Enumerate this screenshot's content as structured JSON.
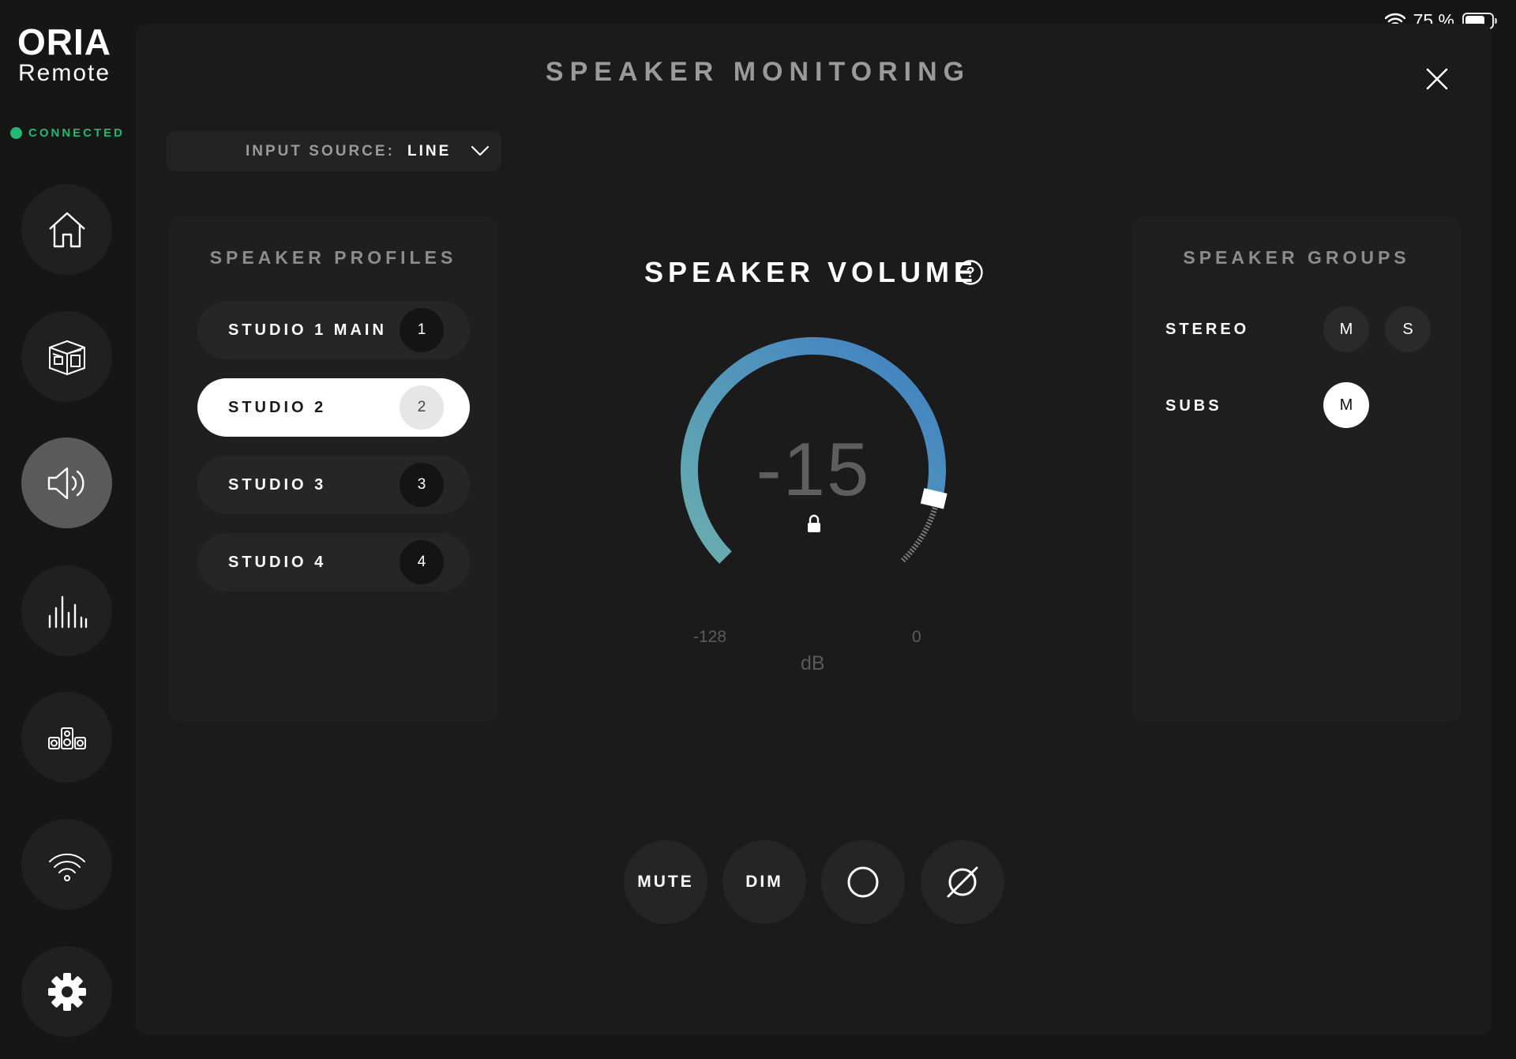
{
  "status_bar": {
    "battery": "75 %",
    "battery_level": 0.75
  },
  "sidebar": {
    "logo_line1": "ORIA",
    "logo_line2": "Remote",
    "connection": "CONNECTED",
    "connection_color": "#25b872",
    "nav": [
      {
        "icon": "home-icon",
        "active": false
      },
      {
        "icon": "room-icon",
        "active": false
      },
      {
        "icon": "speaker-icon",
        "active": true
      },
      {
        "icon": "equalizer-icon",
        "active": false
      },
      {
        "icon": "speakers-layout-icon",
        "active": false
      },
      {
        "icon": "wifi-icon",
        "active": false
      },
      {
        "icon": "gear-icon",
        "active": false
      }
    ]
  },
  "page": {
    "title": "SPEAKER MONITORING"
  },
  "input_source": {
    "label": "INPUT SOURCE:",
    "value": "LINE"
  },
  "profiles": {
    "title": "SPEAKER PROFILES",
    "items": [
      {
        "name": "STUDIO 1 MAIN",
        "num": "1",
        "active": false
      },
      {
        "name": "STUDIO 2",
        "num": "2",
        "active": true
      },
      {
        "name": "STUDIO 3",
        "num": "3",
        "active": false
      },
      {
        "name": "STUDIO 4",
        "num": "4",
        "active": false
      }
    ]
  },
  "volume": {
    "title": "SPEAKER VOLUME",
    "value": "-15",
    "value_num": -15,
    "min": "-128",
    "max": "0",
    "min_num": -128,
    "max_num": 0,
    "unit": "dB",
    "locked": true,
    "gradient_start": "#6aaeae",
    "gradient_end": "#3e7fc4"
  },
  "groups": {
    "title": "SPEAKER GROUPS",
    "items": [
      {
        "name": "STEREO",
        "m_label": "M",
        "s_label": "S",
        "m_on": false,
        "s_on": false
      },
      {
        "name": "SUBS",
        "m_label": "M",
        "m_on": true
      }
    ]
  },
  "controls": {
    "mute": "MUTE",
    "dim": "DIM"
  }
}
